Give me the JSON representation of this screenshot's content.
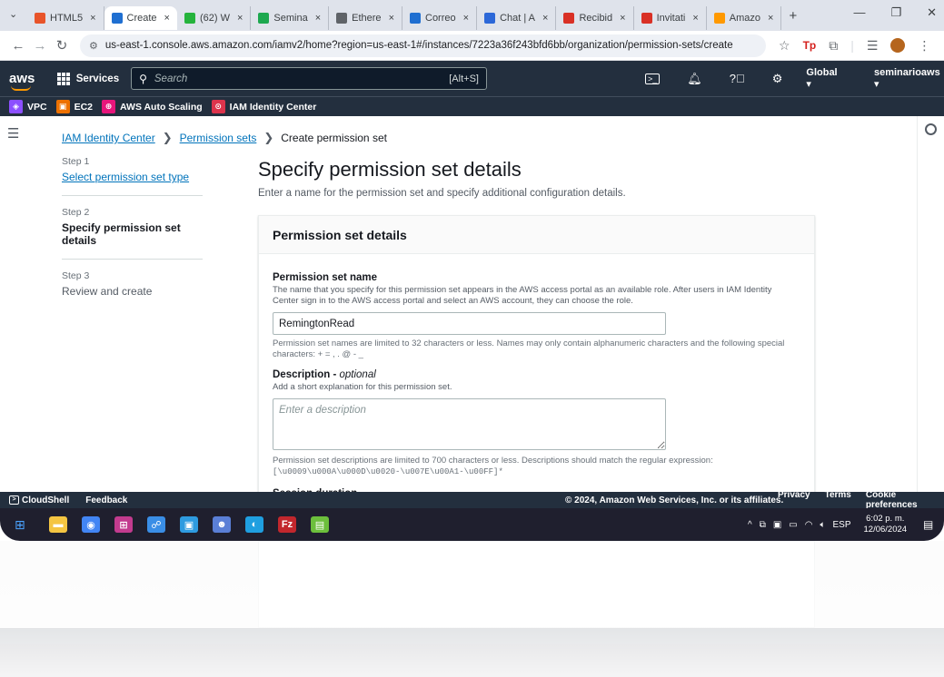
{
  "browser": {
    "tabs": [
      {
        "label": "HTML5",
        "color": "#e8542a"
      },
      {
        "label": "Create",
        "color": "#1f6fd1",
        "active": true
      },
      {
        "label": "(62) W",
        "color": "#25b33c"
      },
      {
        "label": "Semina",
        "color": "#1da84f"
      },
      {
        "label": "Ethere",
        "color": "#5f6368"
      },
      {
        "label": "Correo",
        "color": "#1f6fd1"
      },
      {
        "label": "Chat | A",
        "color": "#2c68d8"
      },
      {
        "label": "Recibid",
        "color": "#d93025"
      },
      {
        "label": "Invitati",
        "color": "#d93025"
      },
      {
        "label": "Amazo",
        "color": "#ff9900"
      }
    ],
    "close_glyph": "×",
    "new_tab": "+",
    "url": "us-east-1.console.aws.amazon.com/iamv2/home?region=us-east-1#/instances/7223a36f243bfd6bb/organization/permission-sets/create"
  },
  "aws_nav": {
    "logo": "aws",
    "services": "Services",
    "search_placeholder": "Search",
    "search_shortcut": "[Alt+S]",
    "region": "Global ▾",
    "account": "seminarioaws ▾"
  },
  "favorites": [
    {
      "label": "VPC",
      "color": "#8c4fff",
      "glyph": "◈"
    },
    {
      "label": "EC2",
      "color": "#ed7100",
      "glyph": "▣"
    },
    {
      "label": "AWS Auto Scaling",
      "color": "#e7157b",
      "glyph": "⊕"
    },
    {
      "label": "IAM Identity Center",
      "color": "#dd344c",
      "glyph": "⊙"
    }
  ],
  "breadcrumb": {
    "items": [
      "IAM Identity Center",
      "Permission sets"
    ],
    "current": "Create permission set",
    "separator": "❯"
  },
  "steps": [
    {
      "num": "Step 1",
      "label": "Select permission set type"
    },
    {
      "num": "Step 2",
      "label": "Specify permission set details"
    },
    {
      "num": "Step 3",
      "label": "Review and create"
    }
  ],
  "page": {
    "title": "Specify permission set details",
    "description": "Enter a name for the permission set and specify additional configuration details."
  },
  "panel": {
    "header": "Permission set details",
    "name_label": "Permission set name",
    "name_desc": "The name that you specify for this permission set appears in the AWS access portal as an available role. After users in IAM Identity Center sign in to the AWS access portal and select an AWS account, they can choose the role.",
    "name_value": "RemingtonRead",
    "name_constraint": "Permission set names are limited to 32 characters or less. Names may only contain alphanumeric characters and the following special characters: + = , . @ - _",
    "desc_label": "Description",
    "desc_optional": "optional",
    "desc_help": "Add a short explanation for this permission set.",
    "desc_placeholder": "Enter a description",
    "desc_constraint": "Permission set descriptions are limited to 700 characters or less. Descriptions should match the regular expression:",
    "desc_regex": "[\\u0009\\u000A\\u000D\\u0020-\\u007E\\u00A1-\\u00FF]*",
    "next_label": "Session duration"
  },
  "footer": {
    "cloudshell": "CloudShell",
    "feedback": "Feedback",
    "copyright": "© 2024, Amazon Web Services, Inc. or its affiliates.",
    "links": [
      "Privacy",
      "Terms",
      "Cookie preferences"
    ]
  },
  "taskbar": {
    "apps": [
      {
        "name": "file-explorer",
        "color": "#f4c542",
        "glyph": "▬"
      },
      {
        "name": "chrome",
        "color": "#4285f4",
        "glyph": "◉"
      },
      {
        "name": "app-grid",
        "color": "#c23b8e",
        "glyph": "⊞"
      },
      {
        "name": "network-tool",
        "color": "#3a8ee6",
        "glyph": "☍"
      },
      {
        "name": "photos",
        "color": "#2e9be0",
        "glyph": "▣"
      },
      {
        "name": "character-app",
        "color": "#5a7fd6",
        "glyph": "☻"
      },
      {
        "name": "edge",
        "color": "#1f9fe0",
        "glyph": "◐"
      },
      {
        "name": "filezilla",
        "color": "#c2272d",
        "glyph": "Fz"
      },
      {
        "name": "notepad",
        "color": "#6cbf3c",
        "glyph": "▤"
      }
    ],
    "language": "ESP",
    "time": "6:02 p. m.",
    "date": "12/06/2024"
  }
}
